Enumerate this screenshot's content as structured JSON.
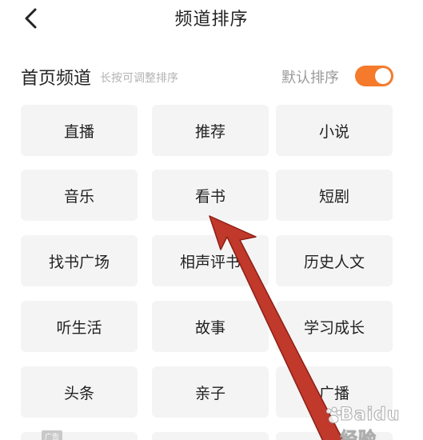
{
  "header": {
    "title": "频道排序"
  },
  "section": {
    "title": "首页频道",
    "hint": "长按可调整排序",
    "sort_label": "默认排序",
    "sort_toggle_on": true
  },
  "channels": [
    "直播",
    "推荐",
    "小说",
    "音乐",
    "看书",
    "短剧",
    "找书广场",
    "相声评书",
    "历史人文",
    "听生活",
    "故事",
    "学习成长",
    "头条",
    "亲子",
    "广播"
  ],
  "watermark": {
    "text": "Baidu 经验",
    "badge": "广告"
  },
  "colors": {
    "accent": "#f57a2c",
    "annotation_arrow": "#c0392b",
    "tile_bg": "#f4f4f4"
  }
}
